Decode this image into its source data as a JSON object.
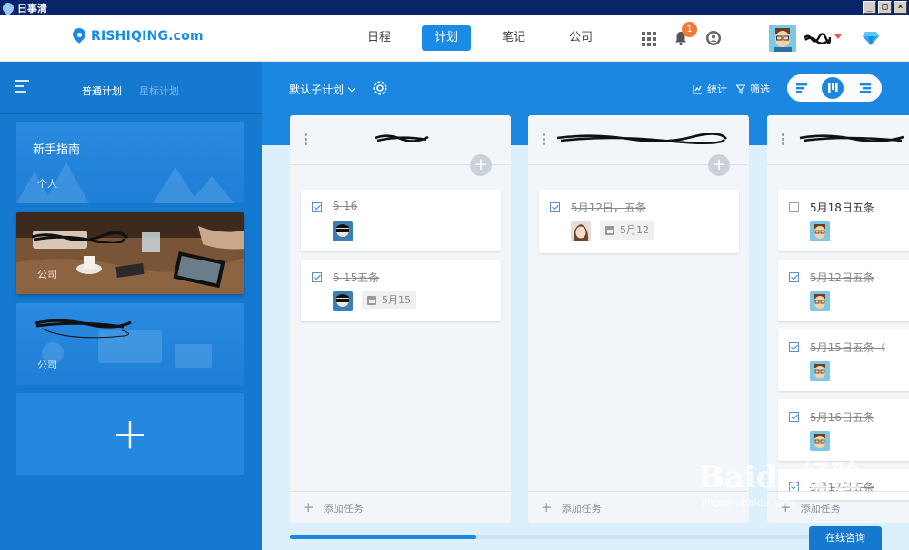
{
  "window": {
    "title": "日事清",
    "buttons": [
      "_",
      "□",
      "×"
    ]
  },
  "header": {
    "logo_text": "RISHIQING.com",
    "nav": [
      "日程",
      "计划",
      "笔记",
      "公司"
    ],
    "active_nav": 1,
    "notification_count": "1",
    "icons": [
      "apps-grid-icon",
      "bell-icon",
      "help-icon",
      "diamond-icon"
    ]
  },
  "sidebar": {
    "tabs": [
      "普通计划",
      "星标计划"
    ],
    "active_tab": 0,
    "cards": [
      {
        "title": "新手指南",
        "type": "个人"
      },
      {
        "title": "",
        "type": "公司"
      },
      {
        "title": "",
        "type": "公司"
      }
    ],
    "add_label": "+"
  },
  "main": {
    "subplan_label": "默认子计划",
    "stats_label": "统计",
    "filter_label": "筛选",
    "columns": [
      {
        "tasks": [
          {
            "title": "5-16",
            "done": true
          },
          {
            "title": "5-15五条",
            "done": true,
            "date": "5月15"
          }
        ],
        "add_task_label": "添加任务"
      },
      {
        "tasks": [
          {
            "title": "5月12日，五条",
            "done": true,
            "date": "5月12"
          }
        ],
        "add_task_label": "添加任务"
      },
      {
        "tasks": [
          {
            "title": "5月18日五条",
            "done": false
          },
          {
            "title": "5月12日五条",
            "done": true
          },
          {
            "title": "5月15日五条（",
            "done": true
          },
          {
            "title": "5月16日五条",
            "done": true
          },
          {
            "title": "5月17日五条",
            "done": true
          }
        ],
        "add_task_label": "添加任务"
      }
    ],
    "scroll_progress": 0.32,
    "consult_label": "在线咨询"
  },
  "watermark": {
    "text": "Baidu经验",
    "url_text": "jingyan.baidu.com"
  },
  "colors": {
    "brand": "#1a8be6",
    "sidebar": "#1679d0",
    "badge": "#f07a3a"
  }
}
